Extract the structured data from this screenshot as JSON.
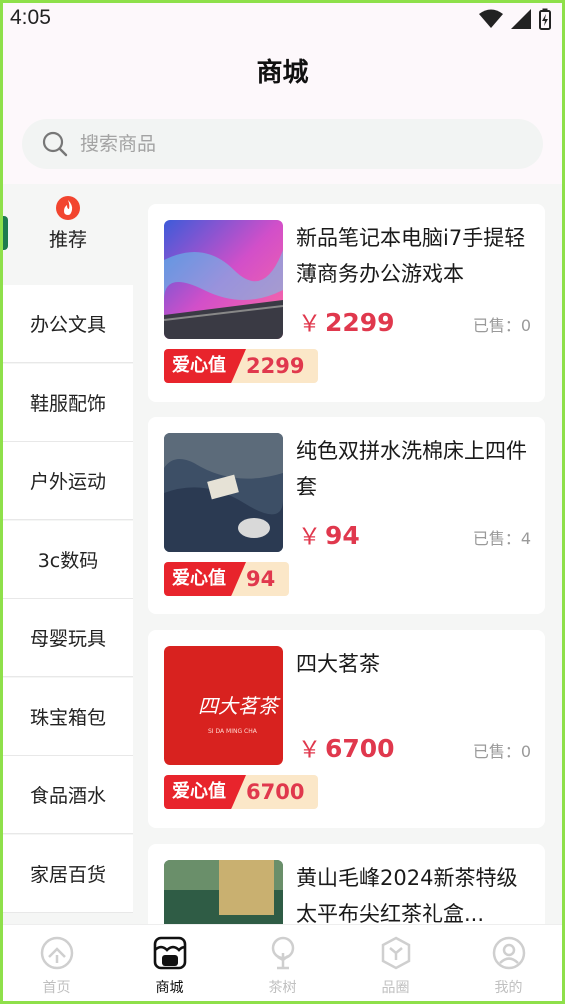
{
  "status_bar": {
    "time": "4:05"
  },
  "header": {
    "title": "商城"
  },
  "search": {
    "placeholder": "搜索商品"
  },
  "sidebar": {
    "items": [
      {
        "label": "推荐",
        "active": true
      },
      {
        "label": "办公文具"
      },
      {
        "label": "鞋服配饰"
      },
      {
        "label": "户外运动"
      },
      {
        "label": "3c数码"
      },
      {
        "label": "母婴玩具"
      },
      {
        "label": "珠宝箱包"
      },
      {
        "label": "食品酒水"
      },
      {
        "label": "家居百货"
      }
    ]
  },
  "products": [
    {
      "title": "新品笔记本电脑i7手提轻薄商务办公游戏本",
      "currency": "￥",
      "price": "2299",
      "sold": "已售：0",
      "love_label": "爱心值",
      "love_value": "2299"
    },
    {
      "title": "纯色双拼水洗棉床上四件套",
      "currency": "￥",
      "price": "94",
      "sold": "已售：4",
      "love_label": "爱心值",
      "love_value": "94"
    },
    {
      "title": "四大茗茶",
      "currency": "￥",
      "price": "6700",
      "sold": "已售：0",
      "love_label": "爱心值",
      "love_value": "6700",
      "image_text": "四大茗茶",
      "image_subtext": "SI DA MING CHA"
    },
    {
      "title": "黄山毛峰2024新茶特级太平布尖红茶礼盒..."
    }
  ],
  "tabbar": {
    "tabs": [
      {
        "label": "首页",
        "icon": "home-icon"
      },
      {
        "label": "商城",
        "icon": "shop-icon",
        "active": true
      },
      {
        "label": "茶树",
        "icon": "tree-icon"
      },
      {
        "label": "品圈",
        "icon": "circle-icon"
      },
      {
        "label": "我的",
        "icon": "profile-icon"
      }
    ]
  },
  "colors": {
    "accent": "#1e7b4d",
    "price": "#e0384d",
    "love_tag": "#e8242c",
    "love_value_bg": "#fbe7c8"
  }
}
